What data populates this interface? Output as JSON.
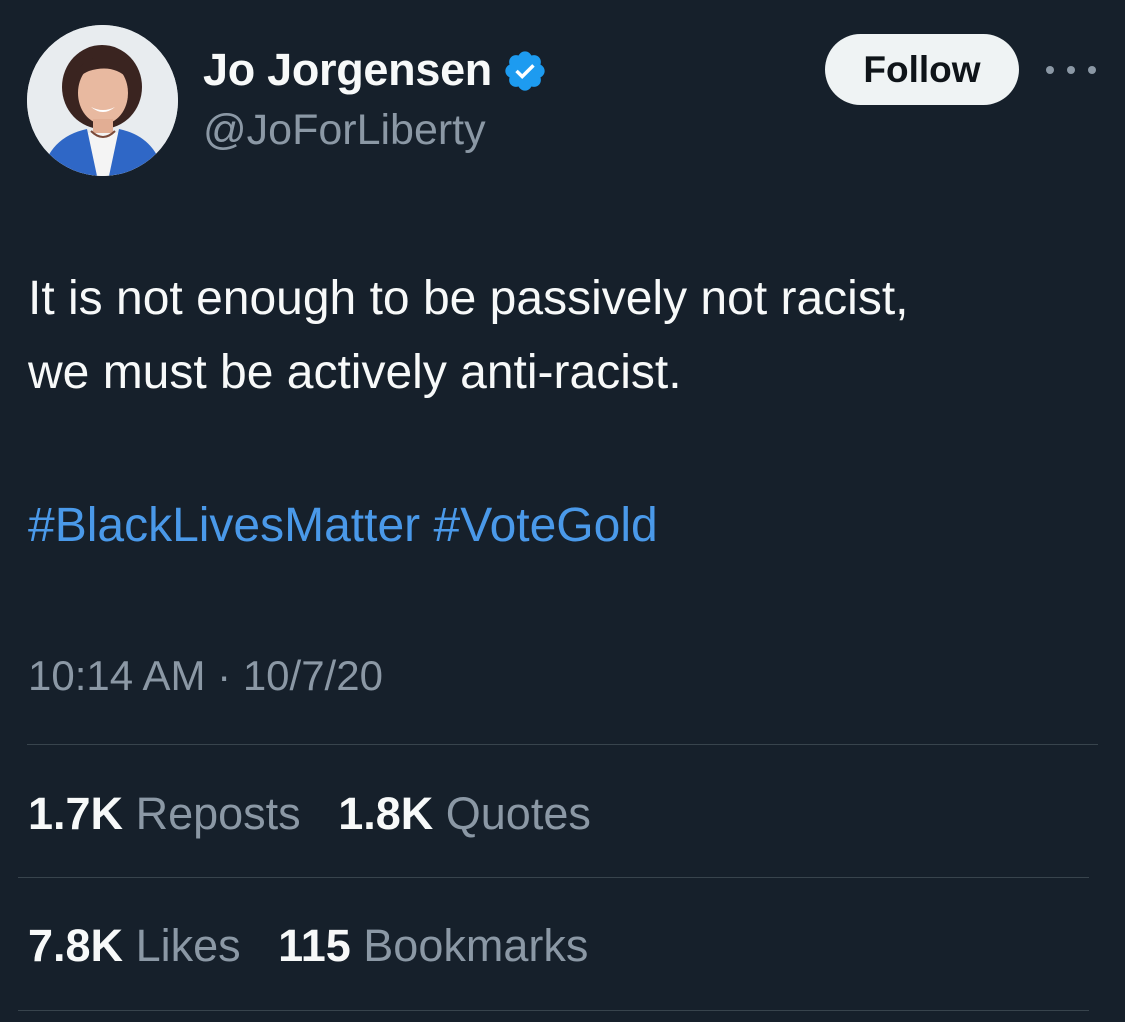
{
  "author": {
    "display_name": "Jo Jorgensen",
    "handle": "@JoForLiberty",
    "verified": true,
    "avatar_icon": "profile-photo"
  },
  "actions": {
    "follow_label": "Follow",
    "more_icon": "ellipsis-icon"
  },
  "tweet": {
    "text_lines": [
      "It is not enough to be passively not racist,",
      "we must be actively anti-racist."
    ],
    "hashtags": [
      "#BlackLivesMatter",
      "#VoteGold"
    ],
    "time": "10:14 AM",
    "separator": "·",
    "date": "10/7/20"
  },
  "stats": {
    "reposts": {
      "value": "1.7K",
      "label": "Reposts"
    },
    "quotes": {
      "value": "1.8K",
      "label": "Quotes"
    },
    "likes": {
      "value": "7.8K",
      "label": "Likes"
    },
    "bookmarks": {
      "value": "115",
      "label": "Bookmarks"
    }
  },
  "colors": {
    "background": "#16202b",
    "text_primary": "#f7f9f9",
    "text_secondary": "#8b98a5",
    "link": "#4a99e9",
    "verified_badge": "#1d9bf0",
    "divider": "#38444d",
    "follow_button_bg": "#eff3f4"
  }
}
